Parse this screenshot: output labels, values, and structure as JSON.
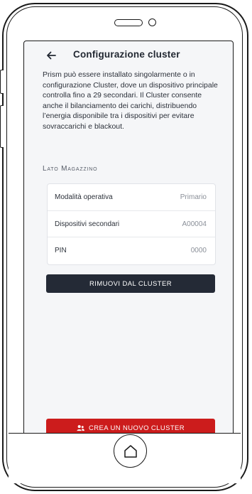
{
  "header": {
    "title": "Configurazione cluster"
  },
  "description": "Prism può essere installato singolarmente o in configurazione Cluster, dove un dispositivo principale controlla fino a 29 secondari. Il Cluster consente anche il bilanciamento dei carichi, distribuendo l’energia disponibile tra i dispositivi per evitare sovraccarichi e blackout.",
  "section": {
    "label": "Lato Magazzino"
  },
  "details": [
    {
      "label": "Modalità operativa",
      "value": "Primario"
    },
    {
      "label": "Dispositivi secondari",
      "value": "A00004"
    },
    {
      "label": "PIN",
      "value": "0000"
    }
  ],
  "actions": {
    "remove_label": "RIMUOVI DAL CLUSTER",
    "create_label": "CREA UN NUOVO CLUSTER"
  },
  "colors": {
    "primary_dark": "#242a36",
    "accent_red": "#cc1c1c",
    "screen_bg": "#f5f6f8"
  },
  "icons": {
    "back": "arrow-left-icon",
    "create": "users-group-icon",
    "home": "home-icon"
  }
}
